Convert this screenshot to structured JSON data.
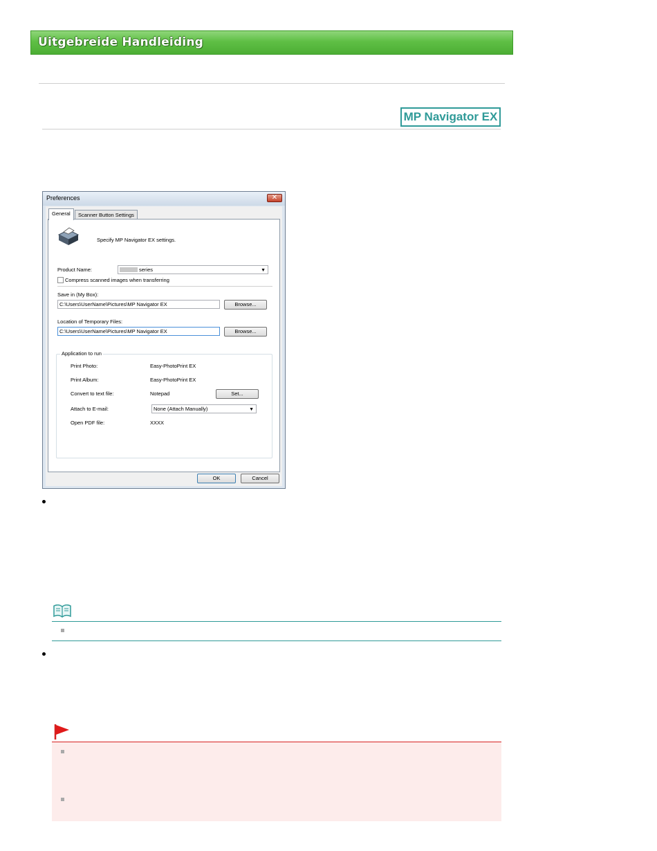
{
  "header": {
    "title": "Uitgebreide Handleiding"
  },
  "product_badge": "MP Navigator EX",
  "dialog": {
    "title": "Preferences",
    "close_glyph": "✕",
    "tabs": [
      {
        "label": "General",
        "active": true
      },
      {
        "label": "Scanner Button Settings",
        "active": false
      }
    ],
    "description": "Specify MP Navigator EX settings.",
    "product_name": {
      "label": "Product Name:",
      "value": "series"
    },
    "compress_checkbox": {
      "label": "Compress scanned images when transferring",
      "checked": false
    },
    "save_in": {
      "label": "Save in (My Box):",
      "value": "C:\\Users\\UserName\\Pictures\\MP Navigator EX",
      "browse_label": "Browse..."
    },
    "temp_location": {
      "label": "Location of Temporary Files:",
      "value": "C:\\Users\\UserName\\Pictures\\MP Navigator EX",
      "browse_label": "Browse..."
    },
    "app_group": {
      "title": "Application to run",
      "rows": [
        {
          "label": "Print Photo:",
          "value": "Easy-PhotoPrint EX"
        },
        {
          "label": "Print Album:",
          "value": "Easy-PhotoPrint EX"
        },
        {
          "label": "Convert to text file:",
          "value": "Notepad",
          "button": "Set..."
        },
        {
          "label": "Attach to E-mail:",
          "select": "None (Attach Manually)"
        },
        {
          "label": "Open PDF file:",
          "value": "XXXX"
        }
      ]
    },
    "ok_label": "OK",
    "cancel_label": "Cancel"
  },
  "colors": {
    "banner_green": "#5fbf45",
    "teal": "#2f9a98",
    "important_red": "#d62020",
    "important_bg": "#fdeceb"
  },
  "icons": {
    "note": "open-book-icon",
    "important": "red-flag-icon",
    "scanner": "scanner-icon"
  }
}
